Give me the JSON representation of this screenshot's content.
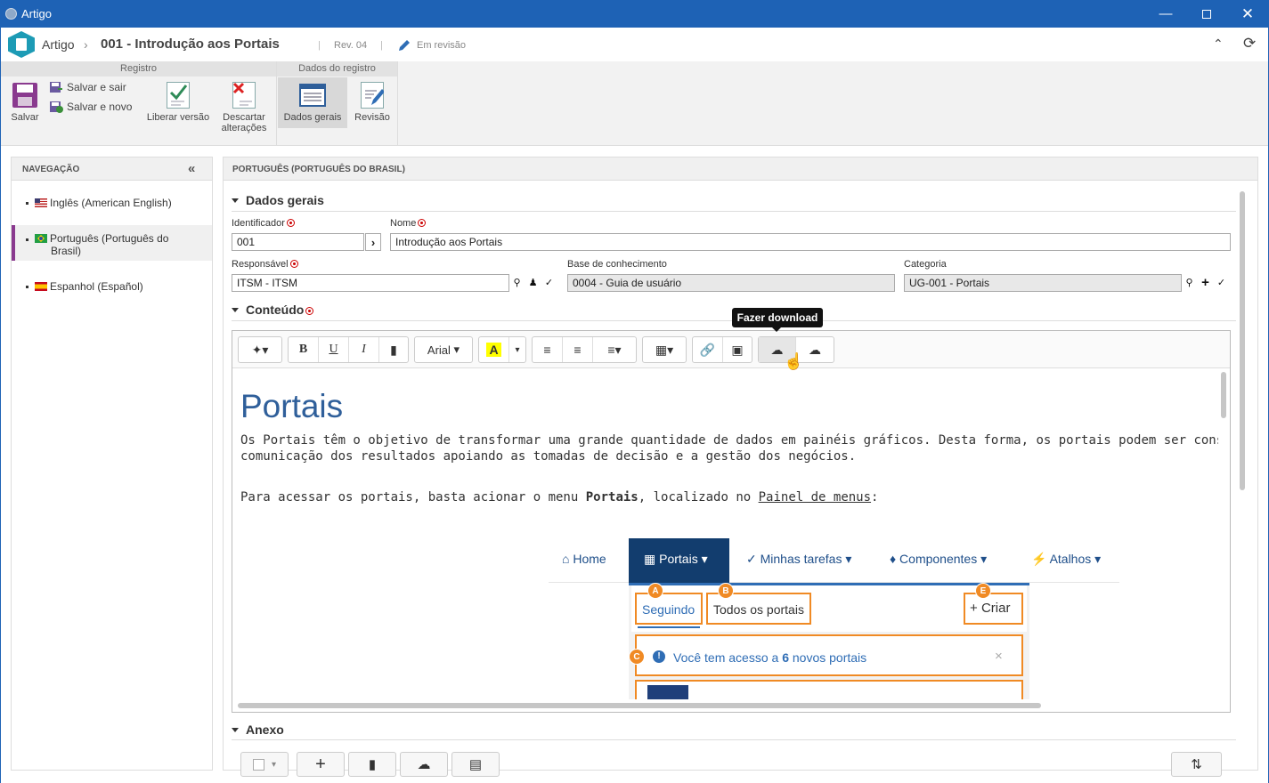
{
  "window": {
    "title": "Artigo"
  },
  "header": {
    "breadcrumb": "Artigo",
    "record_title": "001 - Introdução aos Portais",
    "revision": "Rev. 04",
    "status": "Em revisão"
  },
  "ribbon": {
    "group_registro": "Registro",
    "group_dados": "Dados do registro",
    "salvar": "Salvar",
    "salvar_sair": "Salvar e sair",
    "salvar_novo": "Salvar e novo",
    "liberar": "Liberar versão",
    "descartar_1": "Descartar",
    "descartar_2": "alterações",
    "dados_gerais": "Dados gerais",
    "revisao": "Revisão"
  },
  "nav": {
    "header": "NAVEGAÇÃO",
    "items": [
      {
        "label": "Inglês (American English)"
      },
      {
        "label_1": "Português (Português do",
        "label_2": "Brasil)"
      },
      {
        "label": "Espanhol (Español)"
      }
    ]
  },
  "main": {
    "header": "PORTUGUÊS (PORTUGUÊS DO BRASIL)",
    "section_dados": "Dados gerais",
    "lbl_identificador": "Identificador",
    "val_identificador": "001",
    "lbl_nome": "Nome",
    "val_nome": "Introdução aos Portais",
    "lbl_responsavel": "Responsável",
    "val_responsavel": "ITSM - ITSM",
    "lbl_base": "Base de conhecimento",
    "val_base": "0004 - Guia de usuário",
    "lbl_categoria": "Categoria",
    "val_categoria": "UG-001 - Portais",
    "section_conteudo": "Conteúdo",
    "section_anexo": "Anexo"
  },
  "editor": {
    "font": "Arial",
    "tooltip": "Fazer download",
    "heading": "Portais",
    "p1_line1": "Os Portais têm o objetivo de transformar uma grande quantidade de dados em painéis gráficos. Desta forma, os portais podem ser considerados instrun",
    "p1_line2": "comunicação dos resultados apoiando as tomadas de decisão e a gestão dos negócios.",
    "p2_a": "Para acessar os portais, basta acionar o menu ",
    "p2_bold": "Portais",
    "p2_b": ", localizado no ",
    "p2_link": "Painel de menus",
    "p2_c": ":"
  },
  "embedded": {
    "menu": [
      "Home",
      "Portais",
      "Minhas tarefas",
      "Componentes",
      "Atalhos"
    ],
    "tab_seguindo": "Seguindo",
    "tab_todos": "Todos os portais",
    "criar": "Criar",
    "alert_a": "Você tem acesso a ",
    "alert_count": "6",
    "alert_b": " novos portais",
    "badges": [
      "A",
      "B",
      "E",
      "C"
    ],
    "accent": "#f08a24",
    "menu_active_bg": "#123d6e"
  }
}
